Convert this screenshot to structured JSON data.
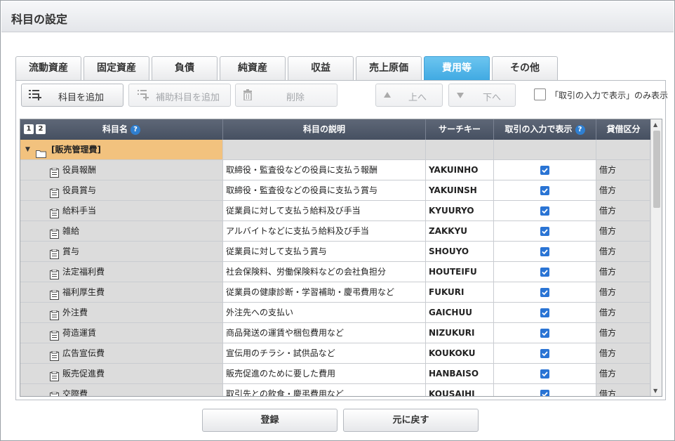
{
  "window": {
    "title": "科目の設定"
  },
  "tabs": [
    {
      "label": "流動資産"
    },
    {
      "label": "固定資産"
    },
    {
      "label": "負債"
    },
    {
      "label": "純資産"
    },
    {
      "label": "収益"
    },
    {
      "label": "売上原価"
    },
    {
      "label": "費用等",
      "active": true
    },
    {
      "label": "その他"
    }
  ],
  "toolbar": {
    "add_account": "科目を追加",
    "add_sub_account": "補助科目を追加",
    "delete": "削除",
    "up": "上へ",
    "down": "下へ",
    "show_only_checkbox_label": "「取引の入力で表示」のみ表示",
    "show_only_checked": false
  },
  "grid": {
    "sort_chips": [
      "1",
      "2"
    ],
    "columns": {
      "name": "科目名",
      "description": "科目の説明",
      "search_key": "サーチキー",
      "show_in_entry": "取引の入力で表示",
      "dc_division": "貸借区分"
    },
    "group": {
      "label": "[販売管理費]",
      "expanded": true
    },
    "rows": [
      {
        "name": "役員報酬",
        "description": "取締役・監査役などの役員に支払う報酬",
        "search_key": "YAKUINHO",
        "show": true,
        "division": "借方"
      },
      {
        "name": "役員賞与",
        "description": "取締役・監査役などの役員に支払う賞与",
        "search_key": "YAKUINSH",
        "show": true,
        "division": "借方"
      },
      {
        "name": "給料手当",
        "description": "従業員に対して支払う給料及び手当",
        "search_key": "KYUURYO",
        "show": true,
        "division": "借方"
      },
      {
        "name": "雑給",
        "description": "アルバイトなどに支払う給料及び手当",
        "search_key": "ZAKKYU",
        "show": true,
        "division": "借方"
      },
      {
        "name": "賞与",
        "description": "従業員に対して支払う賞与",
        "search_key": "SHOUYO",
        "show": true,
        "division": "借方"
      },
      {
        "name": "法定福利費",
        "description": "社会保険料、労働保険料などの会社負担分",
        "search_key": "HOUTEIFU",
        "show": true,
        "division": "借方"
      },
      {
        "name": "福利厚生費",
        "description": "従業員の健康診断・学習補助・慶弔費用など",
        "search_key": "FUKURI",
        "show": true,
        "division": "借方"
      },
      {
        "name": "外注費",
        "description": "外注先への支払い",
        "search_key": "GAICHUU",
        "show": true,
        "division": "借方"
      },
      {
        "name": "荷造運賃",
        "description": "商品発送の運賃や梱包費用など",
        "search_key": "NIZUKURI",
        "show": true,
        "division": "借方"
      },
      {
        "name": "広告宣伝費",
        "description": "宣伝用のチラシ・試供品など",
        "search_key": "KOUKOKU",
        "show": true,
        "division": "借方"
      },
      {
        "name": "販売促進費",
        "description": "販売促進のために要した費用",
        "search_key": "HANBAISO",
        "show": true,
        "division": "借方"
      },
      {
        "name": "交際費",
        "description": "取引先との飲食・慶弔費用など",
        "search_key": "KOUSAIHI",
        "show": true,
        "division": "借方"
      }
    ]
  },
  "footer": {
    "register": "登録",
    "revert": "元に戻す"
  },
  "colors": {
    "active_tab": "#3fa9e2",
    "header": "#4f5869",
    "group_row": "#f2c27e",
    "checkbox": "#2a74d4"
  }
}
